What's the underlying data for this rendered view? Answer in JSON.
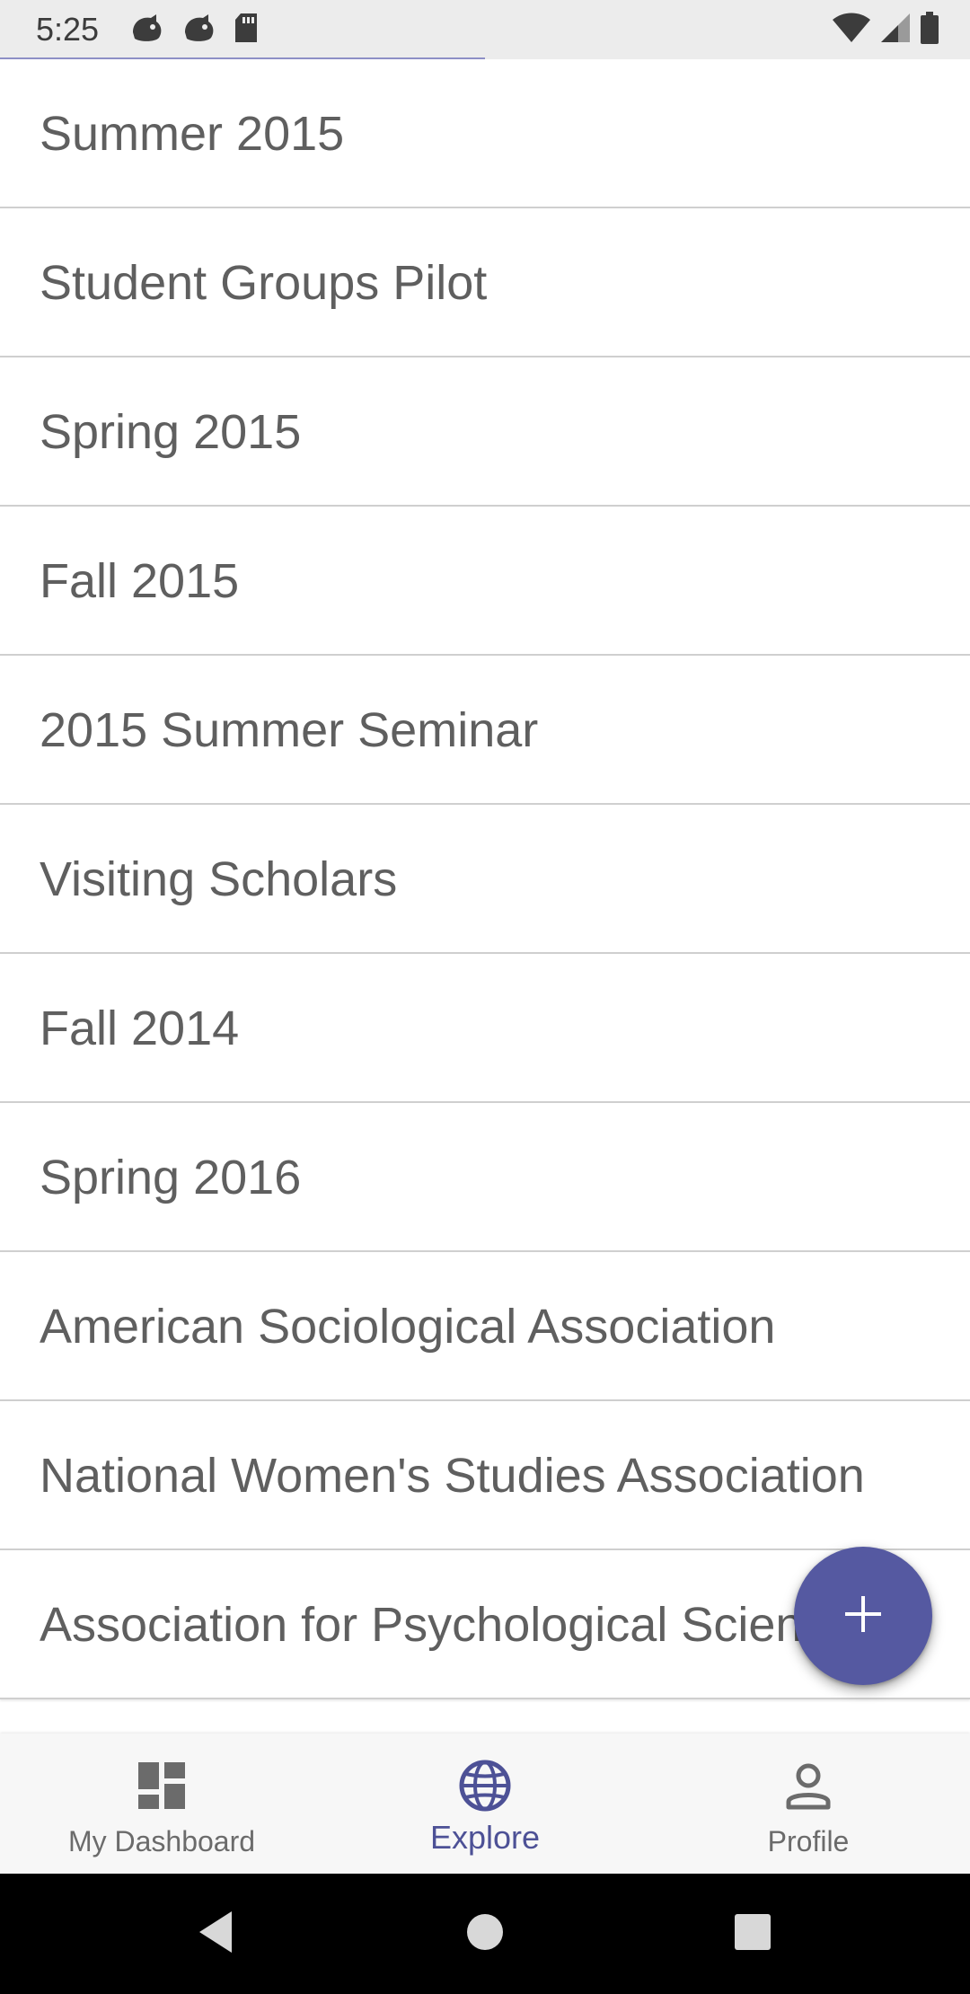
{
  "status_bar": {
    "time": "5:25",
    "left_icons": [
      "notification-icon",
      "notification-icon",
      "sd-card-icon"
    ],
    "right_icons": [
      "wifi-icon",
      "cellular-signal-icon",
      "battery-icon"
    ]
  },
  "list": {
    "items": [
      {
        "label": "Summer 2015"
      },
      {
        "label": "Student Groups Pilot"
      },
      {
        "label": "Spring 2015"
      },
      {
        "label": "Fall 2015"
      },
      {
        "label": "2015 Summer Seminar"
      },
      {
        "label": "Visiting Scholars"
      },
      {
        "label": "Fall 2014"
      },
      {
        "label": "Spring 2016"
      },
      {
        "label": "American Sociological Association"
      },
      {
        "label": "National Women's Studies Association"
      },
      {
        "label": "Association for Psychological Science"
      }
    ]
  },
  "fab": {
    "icon": "plus-icon"
  },
  "bottom_nav": {
    "items": [
      {
        "label": "My Dashboard",
        "icon": "dashboard-icon",
        "active": false
      },
      {
        "label": "Explore",
        "icon": "globe-icon",
        "active": true
      },
      {
        "label": "Profile",
        "icon": "person-icon",
        "active": false
      }
    ]
  },
  "system_nav": {
    "buttons": [
      "back-icon",
      "home-icon",
      "recents-icon"
    ]
  },
  "colors": {
    "accent": "#5559a1",
    "active_nav": "#4d5196",
    "list_text": "#5f5f5f",
    "status_bar_bg": "#ececec"
  }
}
